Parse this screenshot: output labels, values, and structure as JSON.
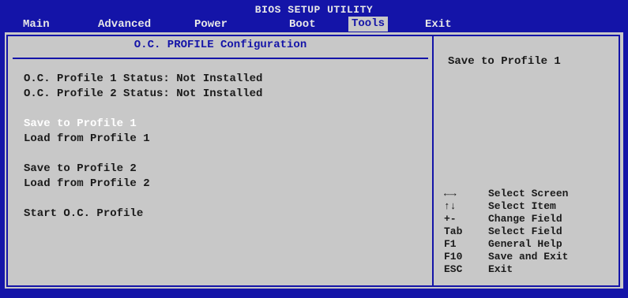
{
  "title": "BIOS SETUP UTILITY",
  "menu": [
    {
      "label": "Main"
    },
    {
      "label": "Advanced"
    },
    {
      "label": "Power"
    },
    {
      "label": "Boot"
    },
    {
      "label": "Tools"
    },
    {
      "label": "Exit"
    }
  ],
  "active_menu": "Tools",
  "panel": {
    "header": "O.C. PROFILE Configuration",
    "status": [
      "O.C. Profile 1 Status: Not Installed",
      "O.C. Profile 2 Status: Not Installed"
    ],
    "items": [
      {
        "label": "Save to Profile 1",
        "selected": true
      },
      {
        "label": "Load from Profile 1",
        "selected": false
      },
      {
        "label": "Save to Profile 2",
        "selected": false
      },
      {
        "label": "Load from Profile 2",
        "selected": false
      },
      {
        "label": "Start O.C. Profile",
        "selected": false
      }
    ]
  },
  "help": {
    "title": "Save to Profile 1",
    "keys": [
      {
        "key": "←→",
        "desc": "Select Screen"
      },
      {
        "key": "↑↓",
        "desc": "Select Item"
      },
      {
        "key": "+-",
        "desc": "Change Field"
      },
      {
        "key": "Tab",
        "desc": "Select Field"
      },
      {
        "key": "F1",
        "desc": "General Help"
      },
      {
        "key": "F10",
        "desc": "Save and Exit"
      },
      {
        "key": "ESC",
        "desc": "Exit"
      }
    ]
  },
  "colors": {
    "background": "#1414a8",
    "panel": "#c8c8c8",
    "text": "#1a1a1a",
    "selected": "#ffffff"
  }
}
